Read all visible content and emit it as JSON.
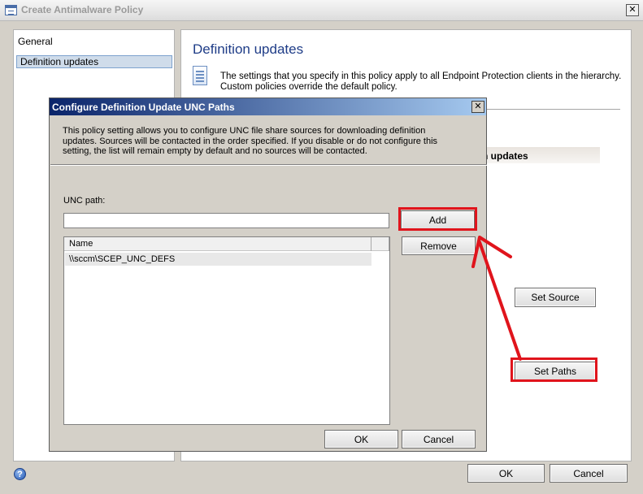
{
  "window": {
    "title": "Create Antimalware Policy",
    "close_glyph": "✕"
  },
  "nav": {
    "items": [
      {
        "label": "General"
      },
      {
        "label": "Definition updates"
      }
    ]
  },
  "content": {
    "heading": "Definition updates",
    "description": "The settings that you specify in this policy apply to all Endpoint Protection clients in the hierarchy. Custom policies override the default policy.",
    "band_label": "n updates",
    "set_source_label": "Set Source",
    "set_paths_label": "Set Paths"
  },
  "footer": {
    "help_glyph": "?",
    "ok_label": "OK",
    "cancel_label": "Cancel"
  },
  "modal": {
    "title": "Configure Definition Update UNC Paths",
    "close_glyph": "✕",
    "description": "This policy setting allows you to configure UNC file share sources for downloading definition updates. Sources will be contacted in the order specified. If you disable or do not configure this setting, the list will remain empty by default and no sources will be contacted.",
    "unc_label": "UNC path:",
    "unc_value": "",
    "add_label": "Add",
    "remove_label": "Remove",
    "list": {
      "columns": [
        "Name"
      ],
      "rows": [
        "\\\\sccm\\SCEP_UNC_DEFS"
      ]
    },
    "ok_label": "OK",
    "cancel_label": "Cancel"
  },
  "annotations": {
    "highlight_color": "#e0141c"
  }
}
